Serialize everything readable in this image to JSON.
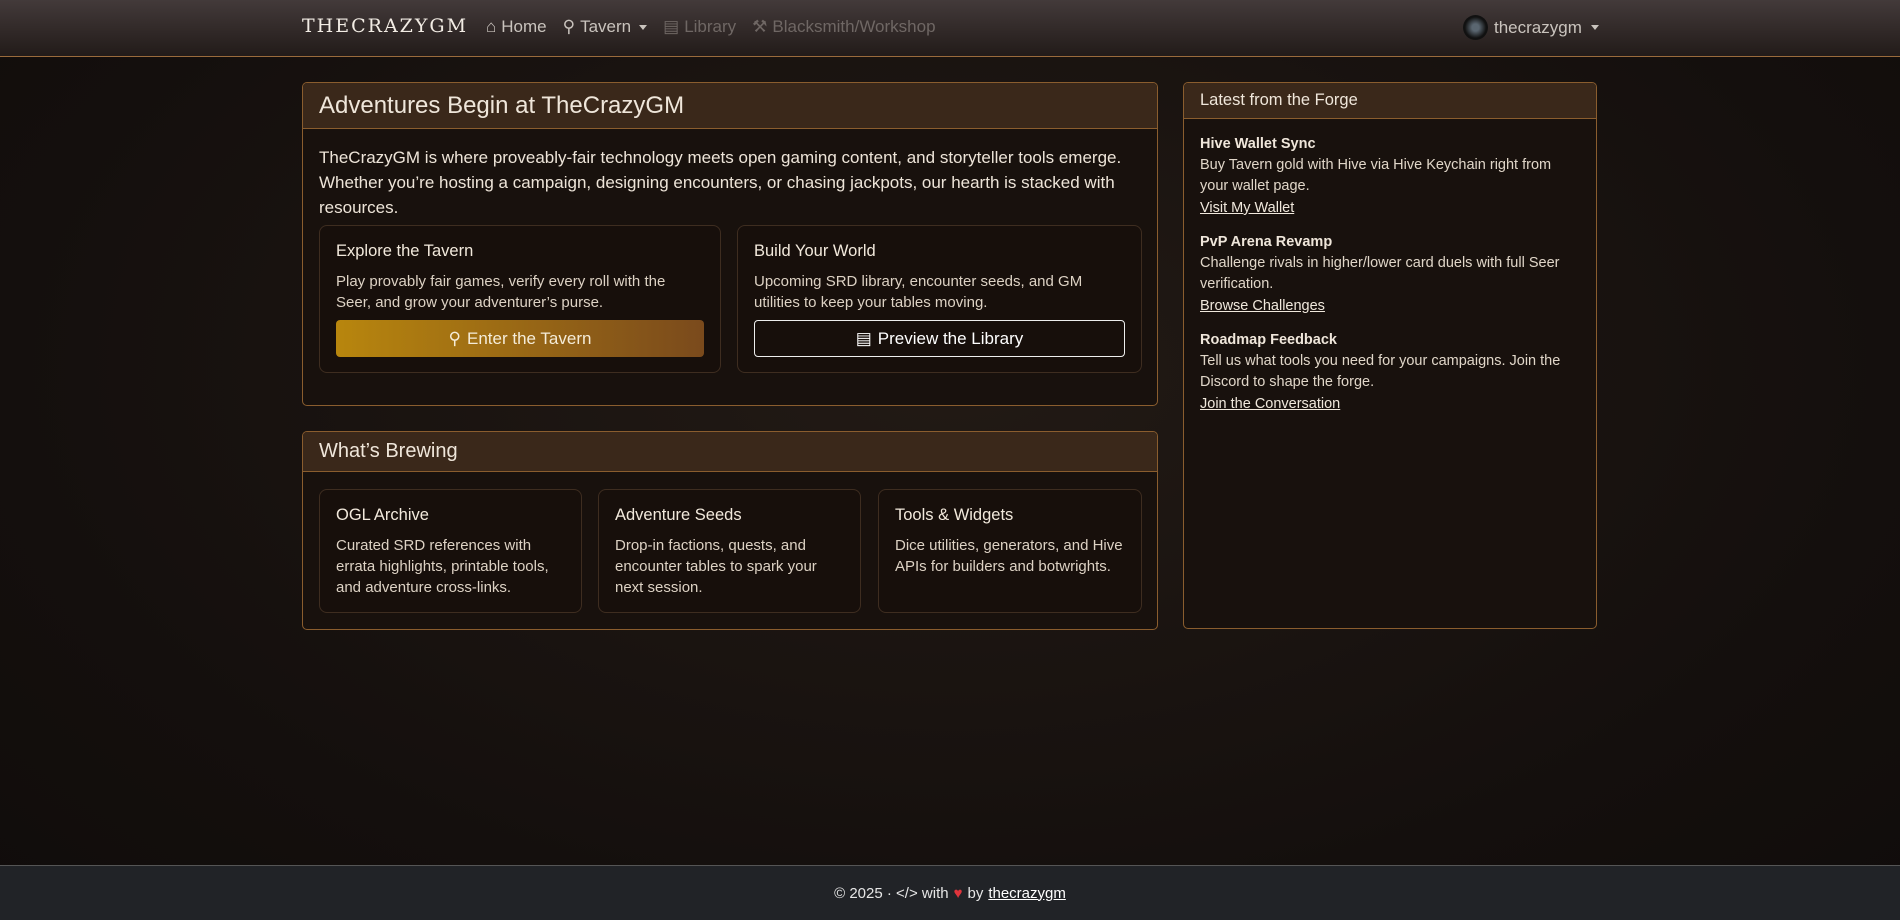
{
  "nav": {
    "brand": "THECRAZYGM",
    "links": [
      {
        "label": "Home",
        "icon": "house-icon"
      },
      {
        "label": "Tavern",
        "icon": "map-pin-icon"
      },
      {
        "label": "Library",
        "icon": "journal-icon"
      },
      {
        "label": "Blacksmith/Workshop",
        "icon": "hammer-icon"
      }
    ],
    "user": "thecrazygm"
  },
  "hero": {
    "title": "Adventures Begin at TheCrazyGM",
    "lead": "TheCrazyGM is where proveably-fair technology meets open gaming content, and storyteller tools emerge. Whether you’re hosting a campaign, designing encounters, or chasing jackpots, our hearth is stacked with resources.",
    "cards": [
      {
        "title": "Explore the Tavern",
        "text": "Play provably fair games, verify every roll with the Seer, and grow your adventurer’s purse.",
        "button": "Enter the Tavern"
      },
      {
        "title": "Build Your World",
        "text": "Upcoming SRD library, encounter seeds, and GM utilities to keep your tables moving.",
        "button": "Preview the Library"
      }
    ]
  },
  "brewing": {
    "title": "What’s Brewing",
    "cards": [
      {
        "title": "OGL Archive",
        "text": "Curated SRD references with errata highlights, printable tools, and adventure cross-links."
      },
      {
        "title": "Adventure Seeds",
        "text": "Drop-in factions, quests, and encounter tables to spark your next session."
      },
      {
        "title": "Tools & Widgets",
        "text": "Dice utilities, generators, and Hive APIs for builders and botwrights."
      }
    ]
  },
  "forge": {
    "title": "Latest from the Forge",
    "items": [
      {
        "title": "Hive Wallet Sync",
        "text": "Buy Tavern gold with Hive via Hive Keychain right from your wallet page.",
        "link": "Visit My Wallet"
      },
      {
        "title": "PvP Arena Revamp",
        "text": "Challenge rivals in higher/lower card duels with full Seer verification.",
        "link": "Browse Challenges"
      },
      {
        "title": "Roadmap Feedback",
        "text": "Tell us what tools you need for your campaigns. Join the Discord to shape the forge.",
        "link": "Join the Conversation"
      }
    ]
  },
  "footer": {
    "prefix": "© 2025 · </> with",
    "heart": "♥",
    "by": "by",
    "author": "thecrazygm"
  }
}
